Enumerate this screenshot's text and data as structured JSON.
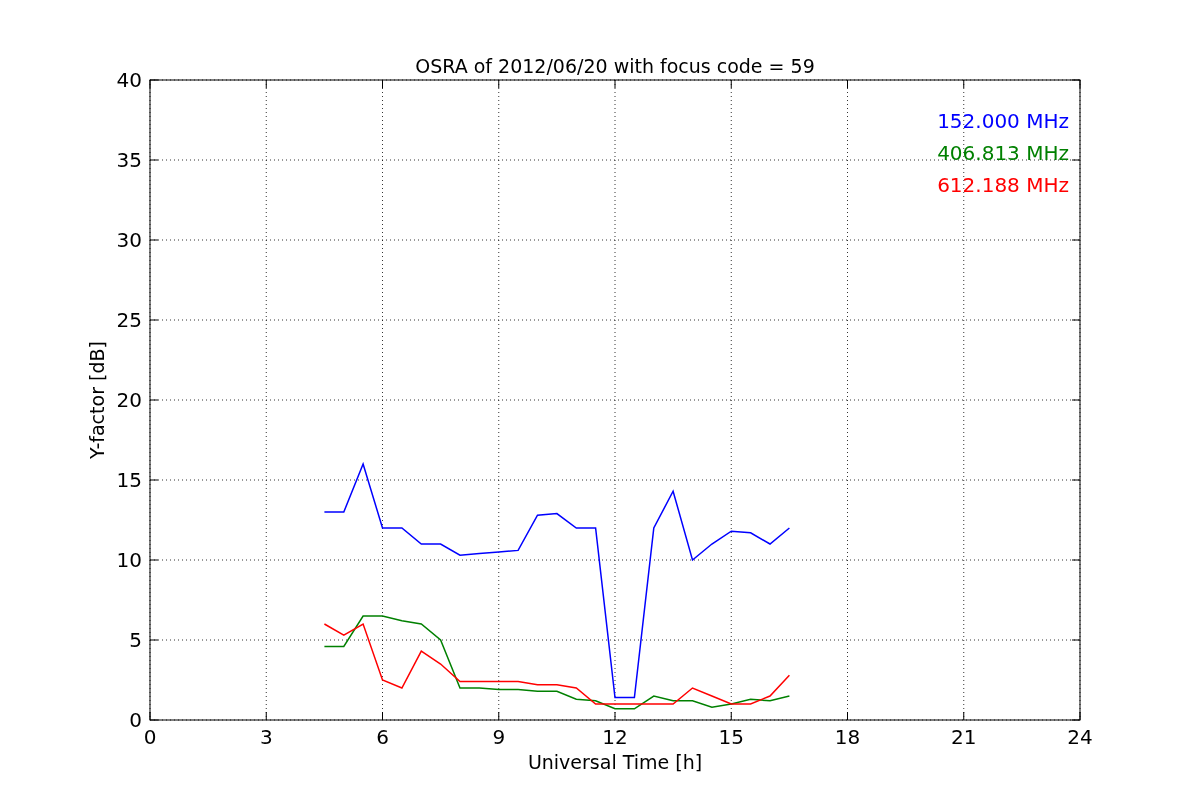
{
  "figure": {
    "chart_data": {
      "type": "line",
      "title": "OSRA of 2012/06/20 with focus code = 59",
      "xlabel": "Universal Time [h]",
      "ylabel": "Y-factor [dB]",
      "x": [
        4.5,
        5,
        5.5,
        6,
        6.5,
        7,
        7.5,
        8,
        8.5,
        9,
        9.5,
        10,
        10.5,
        11,
        11.5,
        12,
        12.5,
        13,
        13.5,
        14,
        14.5,
        15,
        15.5,
        16,
        16.5
      ],
      "series": [
        {
          "name": "152.000 MHz",
          "color": "#0000ff",
          "values": [
            13,
            13,
            16,
            12,
            12,
            11,
            11,
            10.3,
            10.4,
            10.5,
            10.6,
            12.8,
            12.9,
            12,
            12,
            1.4,
            1.4,
            12,
            14.3,
            10,
            11,
            11.8,
            11.7,
            11,
            12
          ]
        },
        {
          "name": "406.813 MHz",
          "color": "#008000",
          "values": [
            4.6,
            4.6,
            6.5,
            6.5,
            6.2,
            6,
            5,
            2,
            2,
            1.9,
            1.9,
            1.8,
            1.8,
            1.3,
            1.2,
            0.7,
            0.7,
            1.5,
            1.2,
            1.2,
            0.8,
            1,
            1.3,
            1.2,
            1.5
          ]
        },
        {
          "name": "612.188 MHz",
          "color": "#ff0000",
          "values": [
            6,
            5.3,
            6,
            2.5,
            2,
            4.3,
            3.5,
            2.4,
            2.4,
            2.4,
            2.4,
            2.2,
            2.2,
            2,
            1,
            1,
            1,
            1,
            1,
            2,
            1.5,
            1,
            1,
            1.5,
            2.8
          ]
        }
      ],
      "grid": true,
      "xlim": [
        0,
        24
      ],
      "ylim": [
        0,
        40
      ],
      "xticks": [
        0,
        3,
        6,
        9,
        12,
        15,
        18,
        21,
        24
      ],
      "yticks": [
        0,
        5,
        10,
        15,
        20,
        25,
        30,
        35,
        40
      ]
    }
  }
}
